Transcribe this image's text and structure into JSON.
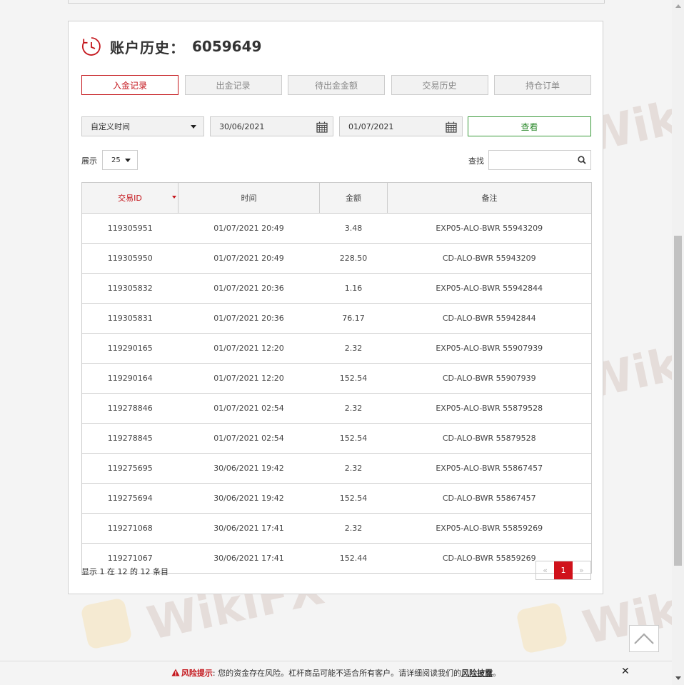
{
  "header": {
    "title": "账户历史：",
    "account_number": "6059649"
  },
  "tabs": [
    {
      "label": "入金记录",
      "active": true
    },
    {
      "label": "出金记录",
      "active": false
    },
    {
      "label": "待出金金额",
      "active": false
    },
    {
      "label": "交易历史",
      "active": false
    },
    {
      "label": "持仓订单",
      "active": false
    }
  ],
  "filters": {
    "range_select": "自定义时间",
    "date_from": "30/06/2021",
    "date_to": "01/07/2021",
    "view_button": "查看"
  },
  "table_controls": {
    "show_label": "展示",
    "page_size": "25",
    "search_label": "查找",
    "search_value": ""
  },
  "table": {
    "columns": [
      "交易ID",
      "时间",
      "金额",
      "备注"
    ],
    "rows": [
      [
        "119305951",
        "01/07/2021 20:49",
        "3.48",
        "EXP05-ALO-BWR 55943209"
      ],
      [
        "119305950",
        "01/07/2021 20:49",
        "228.50",
        "CD-ALO-BWR 55943209"
      ],
      [
        "119305832",
        "01/07/2021 20:36",
        "1.16",
        "EXP05-ALO-BWR 55942844"
      ],
      [
        "119305831",
        "01/07/2021 20:36",
        "76.17",
        "CD-ALO-BWR 55942844"
      ],
      [
        "119290165",
        "01/07/2021 12:20",
        "2.32",
        "EXP05-ALO-BWR 55907939"
      ],
      [
        "119290164",
        "01/07/2021 12:20",
        "152.54",
        "CD-ALO-BWR 55907939"
      ],
      [
        "119278846",
        "01/07/2021 02:54",
        "2.32",
        "EXP05-ALO-BWR 55879528"
      ],
      [
        "119278845",
        "01/07/2021 02:54",
        "152.54",
        "CD-ALO-BWR 55879528"
      ],
      [
        "119275695",
        "30/06/2021 19:42",
        "2.32",
        "EXP05-ALO-BWR 55867457"
      ],
      [
        "119275694",
        "30/06/2021 19:42",
        "152.54",
        "CD-ALO-BWR 55867457"
      ],
      [
        "119271068",
        "30/06/2021 17:41",
        "2.32",
        "EXP05-ALO-BWR 55859269"
      ],
      [
        "119271067",
        "30/06/2021 17:41",
        "152.44",
        "CD-ALO-BWR 55859269"
      ]
    ]
  },
  "pagination": {
    "info": "显示 1 在 12 的 12 条目",
    "prev": "«",
    "current": "1",
    "next": "»"
  },
  "risk_bar": {
    "title": "风险提示",
    "text": ": 您的资金存在风险。杠杆商品可能不适合所有客户。请详细阅读我们的",
    "link": "风险披露",
    "end": "。",
    "close": "✕"
  },
  "watermark": "WikiFX",
  "colors": {
    "accent_red": "#c4161c",
    "view_green": "#2e8b2e"
  }
}
